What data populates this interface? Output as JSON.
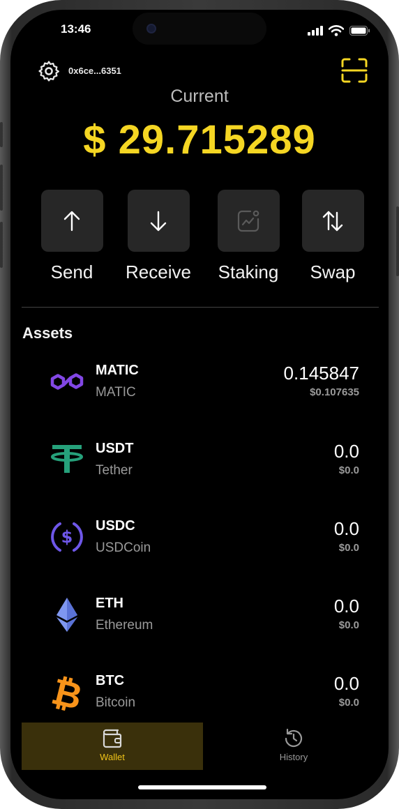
{
  "status_bar": {
    "time": "13:46"
  },
  "header": {
    "address": "0x6ce...6351"
  },
  "balance": {
    "label": "Current",
    "value": "$ 29.715289"
  },
  "actions": [
    {
      "label": "Send",
      "icon": "arrow-up-icon"
    },
    {
      "label": "Receive",
      "icon": "arrow-down-icon"
    },
    {
      "label": "Staking",
      "icon": "chart-icon",
      "disabled": true
    },
    {
      "label": "Swap",
      "icon": "swap-icon"
    }
  ],
  "assets": {
    "title": "Assets",
    "items": [
      {
        "symbol": "MATIC",
        "name": "MATIC",
        "amount": "0.145847",
        "usd": "$0.107635",
        "icon": "polygon-icon",
        "color": "#8247e5"
      },
      {
        "symbol": "USDT",
        "name": "Tether",
        "amount": "0.0",
        "usd": "$0.0",
        "icon": "tether-icon",
        "color": "#26a17b"
      },
      {
        "symbol": "USDC",
        "name": "USDCoin",
        "amount": "0.0",
        "usd": "$0.0",
        "icon": "usdc-icon",
        "color": "#6e57e8"
      },
      {
        "symbol": "ETH",
        "name": "Ethereum",
        "amount": "0.0",
        "usd": "$0.0",
        "icon": "ethereum-icon",
        "color": "#627eea"
      },
      {
        "symbol": "BTC",
        "name": "Bitcoin",
        "amount": "0.0",
        "usd": "$0.0",
        "icon": "bitcoin-icon",
        "color": "#f7931a"
      }
    ]
  },
  "tabs": [
    {
      "label": "Wallet",
      "icon": "wallet-icon",
      "active": true
    },
    {
      "label": "History",
      "icon": "history-icon",
      "active": false
    }
  ],
  "colors": {
    "accent": "#f5d623",
    "background": "#000000",
    "tile": "#272727"
  }
}
